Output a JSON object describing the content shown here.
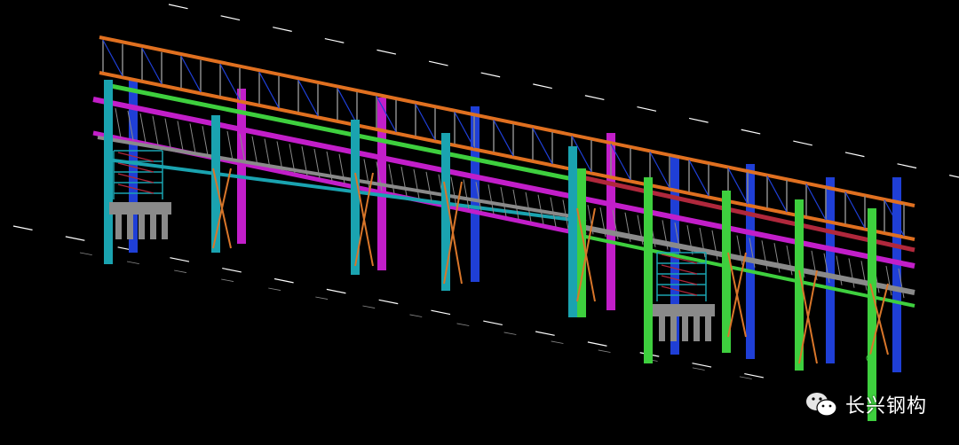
{
  "scene": {
    "type": "3D steel pipe-rack structural model",
    "background": "#000000",
    "colors": {
      "top_truss": "#e07020",
      "girder_green": "#3ecf3e",
      "column_teal": "#1aa3b0",
      "column_magenta": "#c21ec9",
      "column_blue": "#1f3fd6",
      "beam_grey": "#8a8a8a",
      "beam_red": "#b0283c",
      "brace_orange": "#d9762a",
      "cad_line": "#ffffff"
    },
    "icon": "wechat-icon"
  },
  "watermark": {
    "text": "长兴钢构"
  }
}
